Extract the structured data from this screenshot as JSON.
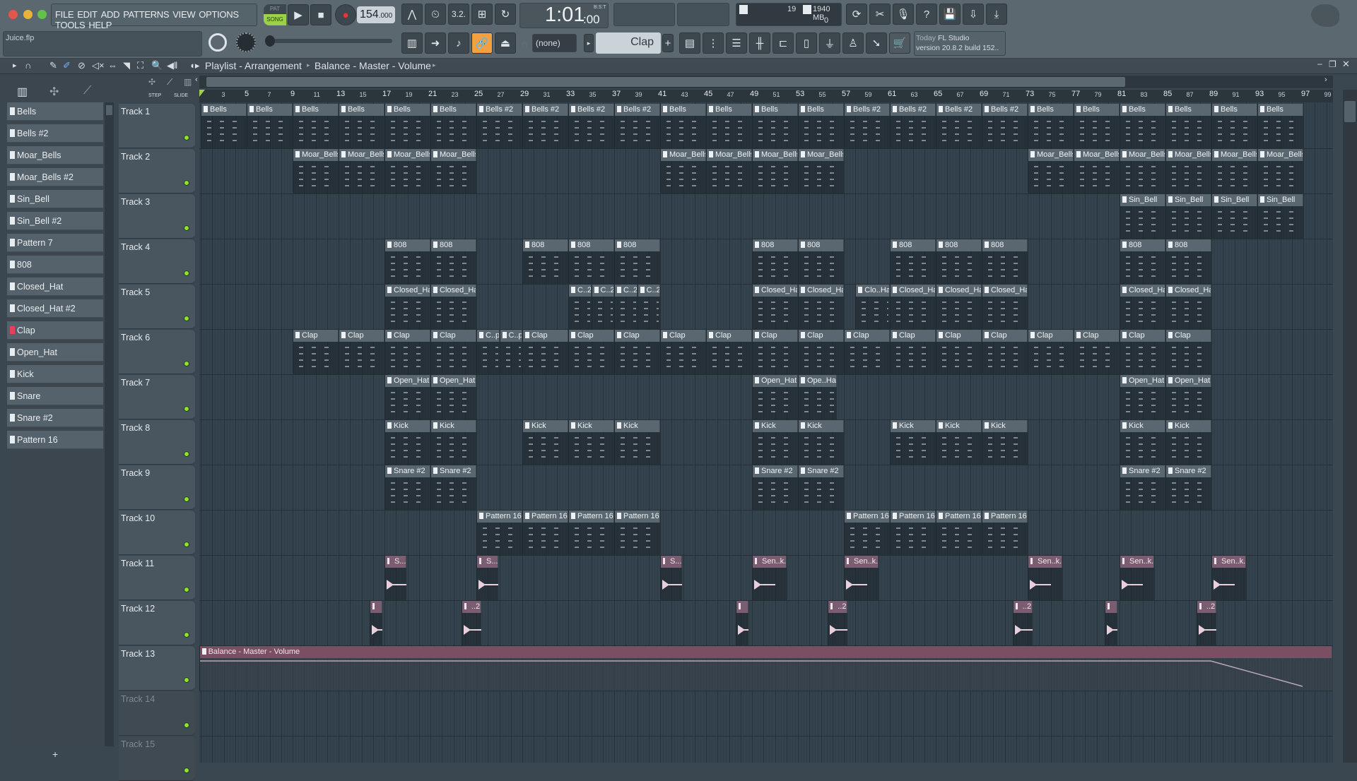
{
  "menu": [
    "FILE",
    "EDIT",
    "ADD",
    "PATTERNS",
    "VIEW",
    "OPTIONS",
    "TOOLS",
    "HELP"
  ],
  "transport": {
    "pat": "PAT",
    "song": "SONG",
    "tempo": "154",
    "tempo_dec": ".000"
  },
  "time": {
    "value": "1:01",
    "sub": ":00",
    "mode": "B:S:T"
  },
  "perf": {
    "cpu": "19",
    "mem": "1940 MB",
    "poly": "0"
  },
  "hint": {
    "line1_prefix": "Today",
    "line1": "FL Studio",
    "line2": "version 20.8.2 build 152.."
  },
  "project": {
    "file": "Juice.flp"
  },
  "channel": {
    "none": "(none)",
    "selected": "Clap",
    "add": "+"
  },
  "playlist": {
    "title": "Playlist - Arrangement",
    "target": "Balance - Master - Volume",
    "step": "STEP",
    "slide": "SLIDE"
  },
  "patterns": [
    "Bells",
    "Bells #2",
    "Moar_Bells",
    "Moar_Bells #2",
    "Sin_Bell",
    "Sin_Bell #2",
    "Pattern 7",
    "808",
    "Closed_Hat",
    "Closed_Hat #2",
    "Clap",
    "Open_Hat",
    "Kick",
    "Snare",
    "Snare #2",
    "Pattern 16"
  ],
  "selected_pattern": "Clap",
  "ruler": [
    3,
    5,
    7,
    9,
    11,
    13,
    15,
    17,
    19,
    21,
    23,
    25,
    27,
    29,
    31,
    33,
    35,
    37,
    39,
    41,
    43,
    45,
    47,
    49,
    51,
    53,
    55,
    57,
    59,
    61,
    63,
    65,
    67,
    69,
    71,
    73,
    75,
    77,
    79,
    81,
    83,
    85,
    87,
    89,
    91,
    93,
    95,
    97,
    99
  ],
  "tracks": [
    {
      "name": "Track 1",
      "clips": [
        [
          "Bells",
          1,
          4
        ],
        [
          "Bells",
          5,
          4
        ],
        [
          "Bells",
          9,
          4
        ],
        [
          "Bells",
          13,
          4
        ],
        [
          "Bells",
          17,
          4
        ],
        [
          "Bells",
          21,
          4
        ],
        [
          "Bells #2",
          25,
          4
        ],
        [
          "Bells #2",
          29,
          4
        ],
        [
          "Bells #2",
          33,
          4
        ],
        [
          "Bells #2",
          37,
          4
        ],
        [
          "Bells",
          41,
          4
        ],
        [
          "Bells",
          45,
          4
        ],
        [
          "Bells",
          49,
          4
        ],
        [
          "Bells",
          53,
          4
        ],
        [
          "Bells #2",
          57,
          4
        ],
        [
          "Bells #2",
          61,
          4
        ],
        [
          "Bells #2",
          65,
          4
        ],
        [
          "Bells #2",
          69,
          4
        ],
        [
          "Bells",
          73,
          4
        ],
        [
          "Bells",
          77,
          4
        ],
        [
          "Bells",
          81,
          4
        ],
        [
          "Bells",
          85,
          4
        ],
        [
          "Bells",
          89,
          4
        ],
        [
          "Bells",
          93,
          4
        ]
      ]
    },
    {
      "name": "Track 2",
      "clips": [
        [
          "Moar_Bells",
          9,
          4
        ],
        [
          "Moar_Bells",
          13,
          4
        ],
        [
          "Moar_Bells",
          17,
          4
        ],
        [
          "Moar_Bells",
          21,
          4
        ],
        [
          "Moar_Bells",
          41,
          4
        ],
        [
          "Moar_Bells",
          45,
          4
        ],
        [
          "Moar_Bells",
          49,
          4
        ],
        [
          "Moar_Bells",
          53,
          4
        ],
        [
          "Moar_Bells",
          73,
          4
        ],
        [
          "Moar_Bells",
          77,
          4
        ],
        [
          "Moar_Bells",
          81,
          4
        ],
        [
          "Moar_Bells",
          85,
          4
        ],
        [
          "Moar_Bells",
          89,
          4
        ],
        [
          "Moar_Bells",
          93,
          4
        ]
      ]
    },
    {
      "name": "Track 3",
      "clips": [
        [
          "Sin_Bell",
          81,
          4
        ],
        [
          "Sin_Bell",
          85,
          4
        ],
        [
          "Sin_Bell",
          89,
          4
        ],
        [
          "Sin_Bell",
          93,
          4
        ]
      ]
    },
    {
      "name": "Track 4",
      "clips": [
        [
          "808",
          17,
          4
        ],
        [
          "808",
          21,
          4
        ],
        [
          "808",
          29,
          4
        ],
        [
          "808",
          33,
          4
        ],
        [
          "808",
          37,
          4
        ],
        [
          "808",
          49,
          4
        ],
        [
          "808",
          53,
          4
        ],
        [
          "808",
          61,
          4
        ],
        [
          "808",
          65,
          4
        ],
        [
          "808",
          69,
          4
        ],
        [
          "808",
          81,
          4
        ],
        [
          "808",
          85,
          4
        ]
      ]
    },
    {
      "name": "Track 5",
      "clips": [
        [
          "Closed_Hat",
          17,
          4
        ],
        [
          "Closed_Hat",
          21,
          4
        ],
        [
          "C..2",
          33,
          2
        ],
        [
          "C..2",
          35,
          2
        ],
        [
          "C..2",
          37,
          2
        ],
        [
          "C..2",
          39,
          2
        ],
        [
          "Closed_Hat",
          49,
          4
        ],
        [
          "Closed_Hat",
          53,
          4
        ],
        [
          "Clo..Hat",
          58,
          3
        ],
        [
          "Closed_Hat",
          61,
          4
        ],
        [
          "Closed_Hat",
          65,
          4
        ],
        [
          "Closed_Hat",
          69,
          4
        ],
        [
          "Closed_Hat",
          81,
          4
        ],
        [
          "Closed_Hat",
          85,
          4
        ]
      ]
    },
    {
      "name": "Track 6",
      "clips": [
        [
          "Clap",
          9,
          4
        ],
        [
          "Clap",
          13,
          4
        ],
        [
          "Clap",
          17,
          4
        ],
        [
          "Clap",
          21,
          4
        ],
        [
          "C..p",
          25,
          2
        ],
        [
          "C..p",
          27,
          2
        ],
        [
          "Clap",
          29,
          4
        ],
        [
          "Clap",
          33,
          4
        ],
        [
          "Clap",
          37,
          4
        ],
        [
          "Clap",
          41,
          4
        ],
        [
          "Clap",
          45,
          4
        ],
        [
          "Clap",
          49,
          4
        ],
        [
          "Clap",
          53,
          4
        ],
        [
          "Clap",
          57,
          4
        ],
        [
          "Clap",
          61,
          4
        ],
        [
          "Clap",
          65,
          4
        ],
        [
          "Clap",
          69,
          4
        ],
        [
          "Clap",
          73,
          4
        ],
        [
          "Clap",
          77,
          4
        ],
        [
          "Clap",
          81,
          4
        ],
        [
          "Clap",
          85,
          4
        ]
      ]
    },
    {
      "name": "Track 7",
      "clips": [
        [
          "Open_Hat",
          17,
          4
        ],
        [
          "Open_Hat",
          21,
          4
        ],
        [
          "Open_Hat",
          49,
          4
        ],
        [
          "Ope..Hat",
          53,
          3.4
        ],
        [
          "Open_Hat",
          81,
          4
        ],
        [
          "Open_Hat",
          85,
          4
        ]
      ]
    },
    {
      "name": "Track 8",
      "clips": [
        [
          "Kick",
          17,
          4
        ],
        [
          "Kick",
          21,
          4
        ],
        [
          "Kick",
          29,
          4
        ],
        [
          "Kick",
          33,
          4
        ],
        [
          "Kick",
          37,
          4
        ],
        [
          "Kick",
          49,
          4
        ],
        [
          "Kick",
          53,
          4
        ],
        [
          "Kick",
          61,
          4
        ],
        [
          "Kick",
          65,
          4
        ],
        [
          "Kick",
          69,
          4
        ],
        [
          "Kick",
          81,
          4
        ],
        [
          "Kick",
          85,
          4
        ]
      ]
    },
    {
      "name": "Track 9",
      "clips": [
        [
          "Snare #2",
          17,
          4
        ],
        [
          "Snare #2",
          21,
          4
        ],
        [
          "Snare #2",
          49,
          4
        ],
        [
          "Snare #2",
          53,
          4
        ],
        [
          "Snare #2",
          81,
          4
        ],
        [
          "Snare #2",
          85,
          4
        ]
      ]
    },
    {
      "name": "Track 10",
      "clips": [
        [
          "Pattern 16",
          25,
          4
        ],
        [
          "Pattern 16",
          29,
          4
        ],
        [
          "Pattern 16",
          33,
          4
        ],
        [
          "Pattern 16",
          37,
          4
        ],
        [
          "Pattern 16",
          57,
          4
        ],
        [
          "Pattern 16",
          61,
          4
        ],
        [
          "Pattern 16",
          65,
          4
        ],
        [
          "Pattern 16",
          69,
          4
        ]
      ]
    },
    {
      "name": "Track 11",
      "type": "audio",
      "clips": [
        [
          "S....",
          17,
          1.9
        ],
        [
          "S....",
          25,
          1.9
        ],
        [
          "S....",
          41,
          1.9
        ],
        [
          "Sen..k...",
          49,
          3
        ],
        [
          "Sen..k...",
          57,
          3
        ],
        [
          "Sen..k...",
          73,
          3
        ],
        [
          "Sen..k...",
          81,
          3
        ],
        [
          "Sen..k...",
          89,
          3
        ]
      ]
    },
    {
      "name": "Track 12",
      "type": "audio",
      "clips": [
        [
          "",
          15.7,
          1.1
        ],
        [
          "..2",
          23.7,
          1.7
        ],
        [
          "",
          47.6,
          1.1
        ],
        [
          "..2",
          55.6,
          1.7
        ],
        [
          "..2",
          71.7,
          1.7
        ],
        [
          "",
          79.7,
          1.1
        ],
        [
          "..2",
          87.7,
          1.7
        ]
      ]
    },
    {
      "name": "Track 13",
      "type": "auto",
      "clips": [
        [
          "Balance - Master - Volume",
          0.85,
          98.7
        ]
      ]
    },
    {
      "name": "Track 14",
      "dim": true,
      "clips": []
    },
    {
      "name": "Track 15",
      "dim": true,
      "clips": []
    }
  ]
}
